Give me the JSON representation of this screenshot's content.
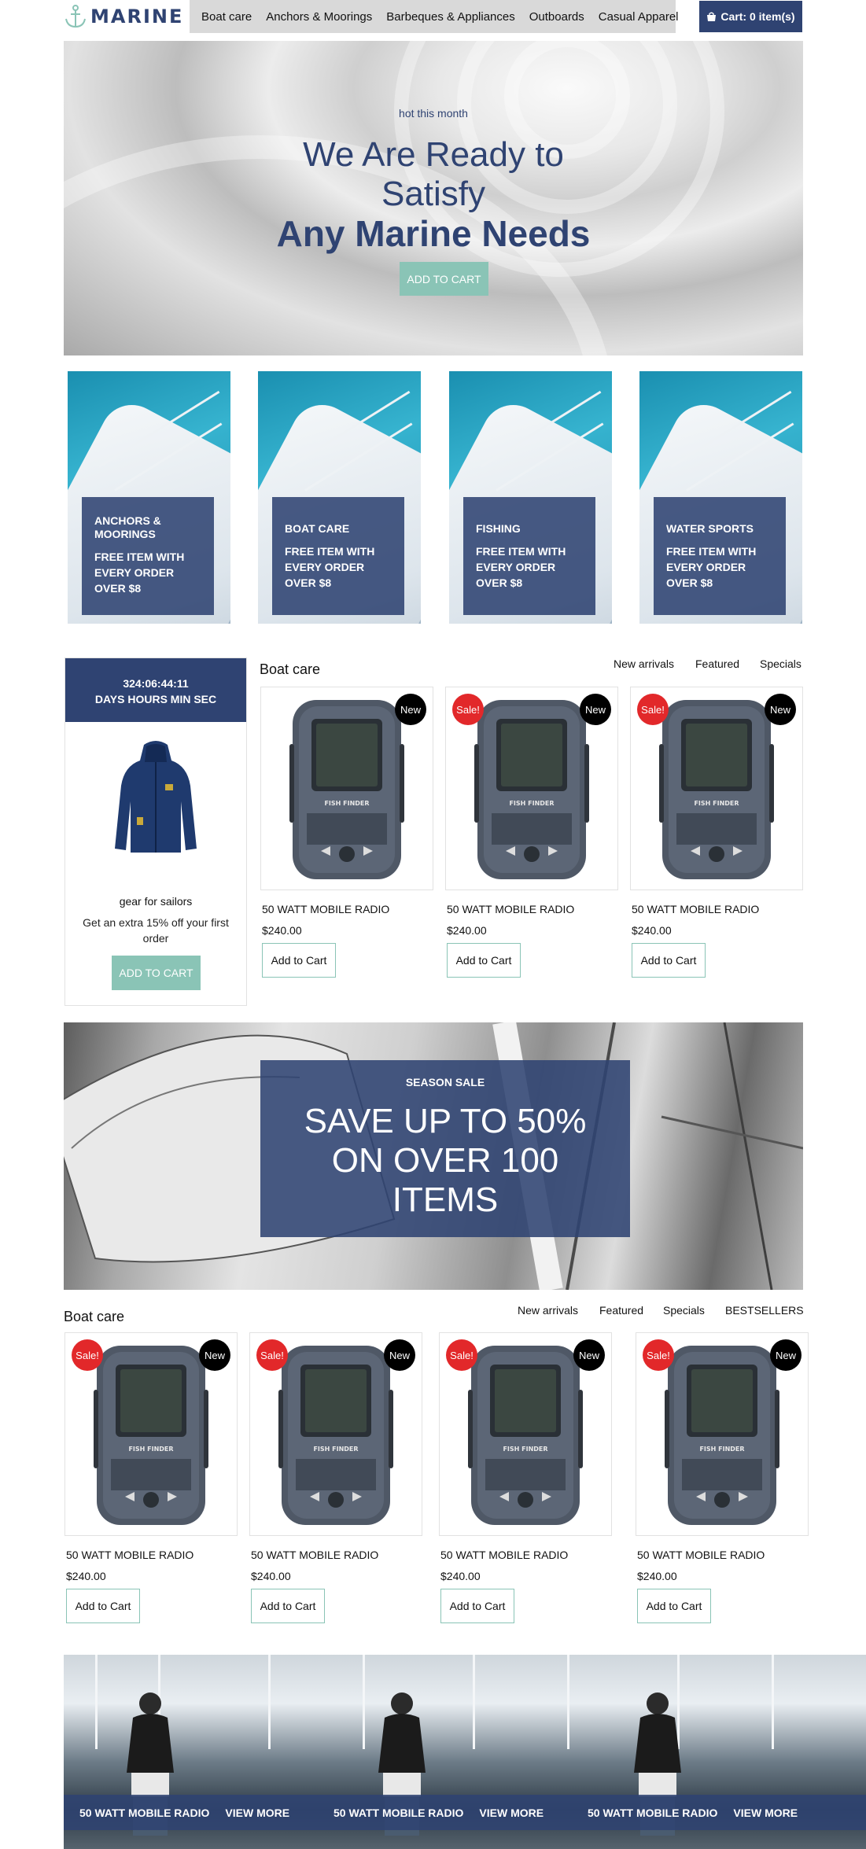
{
  "header": {
    "logo_text": "MARINE",
    "nav": [
      "Boat care",
      "Anchors & Moorings",
      "Barbeques & Appliances",
      "Outboards",
      "Casual Apparel"
    ],
    "cart_label": "Cart: 0 item(s)"
  },
  "hero": {
    "eyebrow": "hot this month",
    "line1": "We Are Ready to",
    "line2": "Satisfy",
    "line3": "Any Marine Needs",
    "button": "ADD TO CART"
  },
  "categories": [
    {
      "title": "ANCHORS & MOORINGS",
      "promo": "FREE ITEM WITH EVERY ORDER OVER $8"
    },
    {
      "title": "BOAT CARE",
      "promo": "FREE ITEM WITH EVERY ORDER OVER $8"
    },
    {
      "title": "FISHING",
      "promo": "FREE ITEM WITH EVERY ORDER OVER $8"
    },
    {
      "title": "WATER SPORTS",
      "promo": "FREE ITEM WITH EVERY ORDER OVER $8"
    }
  ],
  "deal": {
    "countdown": "324:06:44:11",
    "countdown_units": "DAYS HOURS MIN SEC",
    "name": "gear for sailors",
    "description": "Get an extra 15% off your first order",
    "button": "ADD TO CART"
  },
  "section1": {
    "title": "Boat care",
    "tabs": [
      "New arrivals",
      "Featured",
      "Specials"
    ],
    "products": [
      {
        "name": "50 WATT MOBILE RADIO",
        "price": "$240.00",
        "button": "Add to Cart",
        "sale": "",
        "new": "New"
      },
      {
        "name": "50 WATT MOBILE RADIO",
        "price": "$240.00",
        "button": "Add to Cart",
        "sale": "Sale!",
        "new": "New"
      },
      {
        "name": "50 WATT MOBILE RADIO",
        "price": "$240.00",
        "button": "Add to Cart",
        "sale": "Sale!",
        "new": "New"
      }
    ]
  },
  "season_sale": {
    "eyebrow": "SEASON SALE",
    "title": "SAVE UP TO 50% ON OVER 100 ITEMS"
  },
  "section2": {
    "title": "Boat care",
    "tabs": [
      "New arrivals",
      "Featured",
      "Specials",
      "BESTSELLERS"
    ],
    "products": [
      {
        "name": "50 WATT MOBILE RADIO",
        "price": "$240.00",
        "button": "Add to Cart",
        "sale": "Sale!",
        "new": "New"
      },
      {
        "name": "50 WATT MOBILE RADIO",
        "price": "$240.00",
        "button": "Add to Cart",
        "sale": "Sale!",
        "new": "New"
      },
      {
        "name": "50 WATT MOBILE RADIO",
        "price": "$240.00",
        "button": "Add to Cart",
        "sale": "Sale!",
        "new": "New"
      },
      {
        "name": "50 WATT MOBILE RADIO",
        "price": "$240.00",
        "button": "Add to Cart",
        "sale": "Sale!",
        "new": "New"
      }
    ]
  },
  "strip": {
    "items": [
      {
        "name": "50 WATT MOBILE RADIO",
        "link": "VIEW MORE"
      },
      {
        "name": "50 WATT MOBILE RADIO",
        "link": "VIEW MORE"
      },
      {
        "name": "50 WATT MOBILE RADIO",
        "link": "VIEW MORE"
      }
    ]
  },
  "colors": {
    "brand": "#2f4372",
    "accent": "#8ac4b6",
    "sale": "#e2282a"
  },
  "icons": {
    "logo": "anchor-icon",
    "cart": "shopping-bag-icon"
  }
}
